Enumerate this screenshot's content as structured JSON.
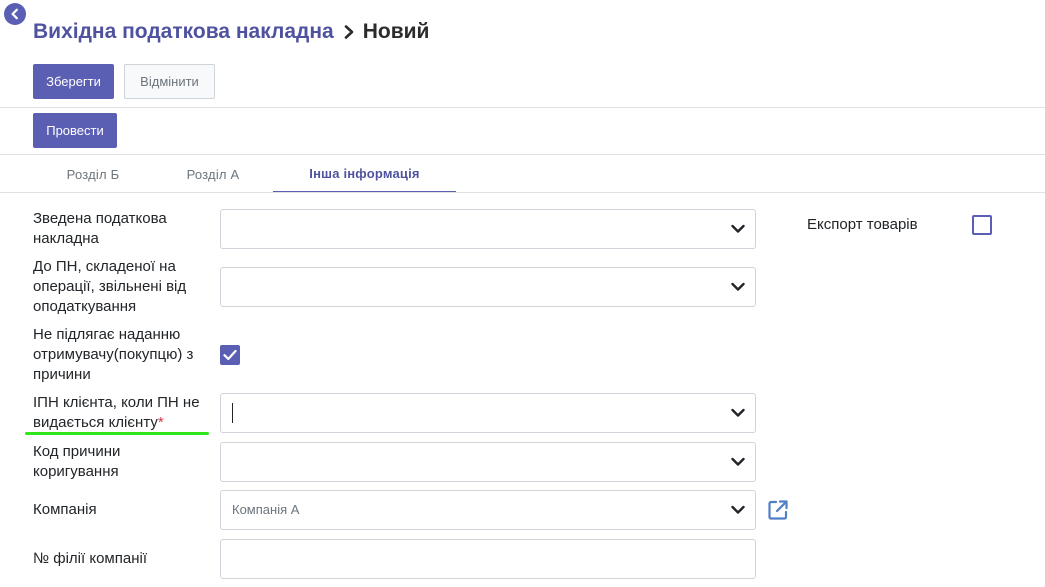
{
  "header": {
    "parent_title": "Вихідна податкова накладна",
    "current_title": "Новий"
  },
  "actions": {
    "save_label": "Зберегти",
    "discard_label": "Відмінити",
    "post_label": "Провести"
  },
  "tabs": [
    {
      "label": "Розділ Б",
      "active": false
    },
    {
      "label": "Розділ А",
      "active": false
    },
    {
      "label": "Інша інформація",
      "active": true
    }
  ],
  "form": {
    "consolidated_label": "Зведена податкова накладна",
    "consolidated_value": "",
    "exempt_label": "До ПН, складеної на операції, звільнені від оподаткування",
    "exempt_value": "",
    "not_issued_label": "Не підлягає наданню отримувачу(покупцю) з причини",
    "not_issued_checked": true,
    "client_ipn_label": "ІПН клієнта, коли ПН не видається клієнту",
    "client_ipn_required_mark": "*",
    "client_ipn_value": "",
    "correction_code_label": "Код причини коригування",
    "correction_code_value": "",
    "company_label": "Компанія",
    "company_placeholder": "Компанія А",
    "branch_label": "№ філії компанії",
    "branch_value": "",
    "export_goods_label": "Експорт товарів",
    "export_goods_checked": false
  },
  "colors": {
    "brand": "#5b5fb4",
    "brand_text": "#4f539f",
    "required": "#dc3545",
    "annotation_underline": "#2fe61a"
  },
  "icons": {
    "back": "arrow-left-circle",
    "breadcrumb_separator": "chevron-right",
    "dropdown": "chevron-down",
    "external_link": "external-link",
    "check": "checkmark"
  }
}
